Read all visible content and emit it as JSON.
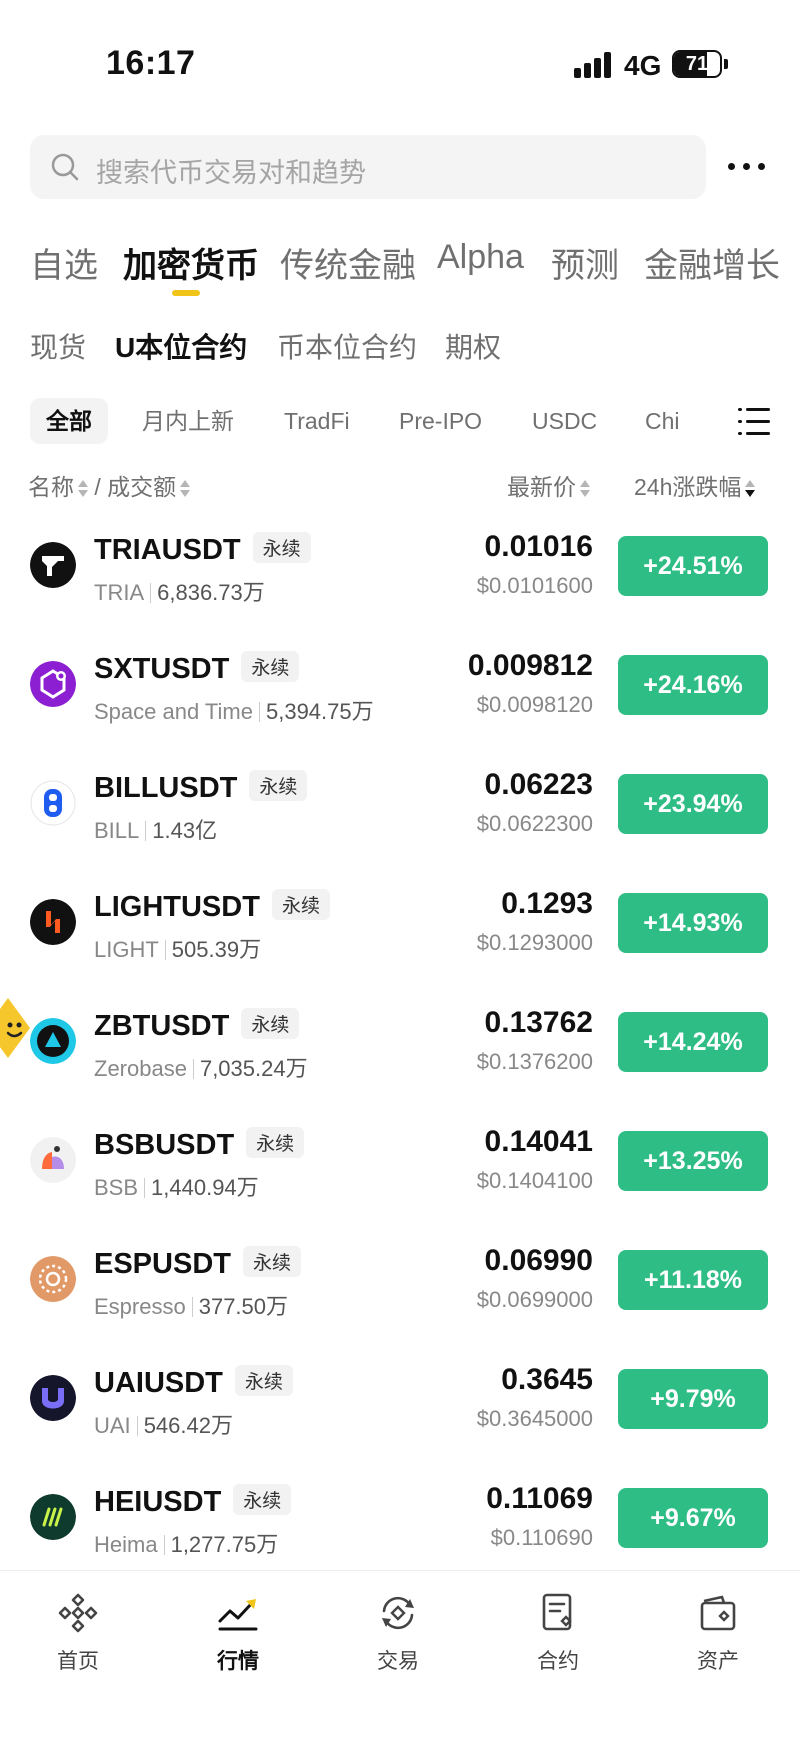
{
  "status_bar": {
    "time": "16:17",
    "network": "4G",
    "battery": "71",
    "battery_level": 0.71
  },
  "search": {
    "placeholder": "搜索代币交易对和趋势"
  },
  "main_tabs": [
    {
      "label": "自选",
      "active": false
    },
    {
      "label": "加密货币",
      "active": true
    },
    {
      "label": "传统金融",
      "active": false
    },
    {
      "label": "Alpha",
      "active": false
    },
    {
      "label": "预测",
      "active": false
    },
    {
      "label": "金融增长",
      "active": false
    }
  ],
  "sub_tabs": [
    {
      "label": "现货",
      "active": false
    },
    {
      "label": "U本位合约",
      "active": true
    },
    {
      "label": "币本位合约",
      "active": false
    },
    {
      "label": "期权",
      "active": false
    }
  ],
  "chips": [
    {
      "label": "全部",
      "active": true
    },
    {
      "label": "月内上新",
      "active": false
    },
    {
      "label": "TradFi",
      "active": false
    },
    {
      "label": "Pre-IPO",
      "active": false
    },
    {
      "label": "USDC",
      "active": false
    },
    {
      "label": "Chi",
      "active": false
    }
  ],
  "header": {
    "name": "名称",
    "slash": "/",
    "volume": "成交额",
    "price": "最新价",
    "change": "24h涨跌幅"
  },
  "rows": [
    {
      "symbol": "TRIAUSDT",
      "tag": "永续",
      "name": "TRIA",
      "volume": "6,836.73万",
      "price": "0.01016",
      "usd": "$0.0101600",
      "change": "+24.51%",
      "icon": "tria-icon"
    },
    {
      "symbol": "SXTUSDT",
      "tag": "永续",
      "name": "Space and Time",
      "volume": "5,394.75万",
      "price": "0.009812",
      "usd": "$0.0098120",
      "change": "+24.16%",
      "icon": "sxt-icon"
    },
    {
      "symbol": "BILLUSDT",
      "tag": "永续",
      "name": "BILL",
      "volume": "1.43亿",
      "price": "0.06223",
      "usd": "$0.0622300",
      "change": "+23.94%",
      "icon": "bill-icon"
    },
    {
      "symbol": "LIGHTUSDT",
      "tag": "永续",
      "name": "LIGHT",
      "volume": "505.39万",
      "price": "0.1293",
      "usd": "$0.1293000",
      "change": "+14.93%",
      "icon": "light-icon"
    },
    {
      "symbol": "ZBTUSDT",
      "tag": "永续",
      "name": "Zerobase",
      "volume": "7,035.24万",
      "price": "0.13762",
      "usd": "$0.1376200",
      "change": "+14.24%",
      "icon": "zbt-icon"
    },
    {
      "symbol": "BSBUSDT",
      "tag": "永续",
      "name": "BSB",
      "volume": "1,440.94万",
      "price": "0.14041",
      "usd": "$0.1404100",
      "change": "+13.25%",
      "icon": "bsb-icon"
    },
    {
      "symbol": "ESPUSDT",
      "tag": "永续",
      "name": "Espresso",
      "volume": "377.50万",
      "price": "0.06990",
      "usd": "$0.0699000",
      "change": "+11.18%",
      "icon": "esp-icon"
    },
    {
      "symbol": "UAIUSDT",
      "tag": "永续",
      "name": "UAI",
      "volume": "546.42万",
      "price": "0.3645",
      "usd": "$0.3645000",
      "change": "+9.79%",
      "icon": "uai-icon"
    },
    {
      "symbol": "HEIUSDT",
      "tag": "永续",
      "name": "Heima",
      "volume": "1,277.75万",
      "price": "0.11069",
      "usd": "$0.110690",
      "change": "+9.67%",
      "icon": "hei-icon"
    }
  ],
  "bottom_nav": [
    {
      "label": "首页",
      "icon": "home-icon",
      "active": false
    },
    {
      "label": "行情",
      "icon": "markets-icon",
      "active": true
    },
    {
      "label": "交易",
      "icon": "trade-icon",
      "active": false
    },
    {
      "label": "合约",
      "icon": "futures-icon",
      "active": false
    },
    {
      "label": "资产",
      "icon": "wallet-icon",
      "active": false
    }
  ],
  "colors": {
    "accent": "#f0c419",
    "up": "#2ebd85",
    "text": "#111111",
    "muted": "#707070"
  }
}
